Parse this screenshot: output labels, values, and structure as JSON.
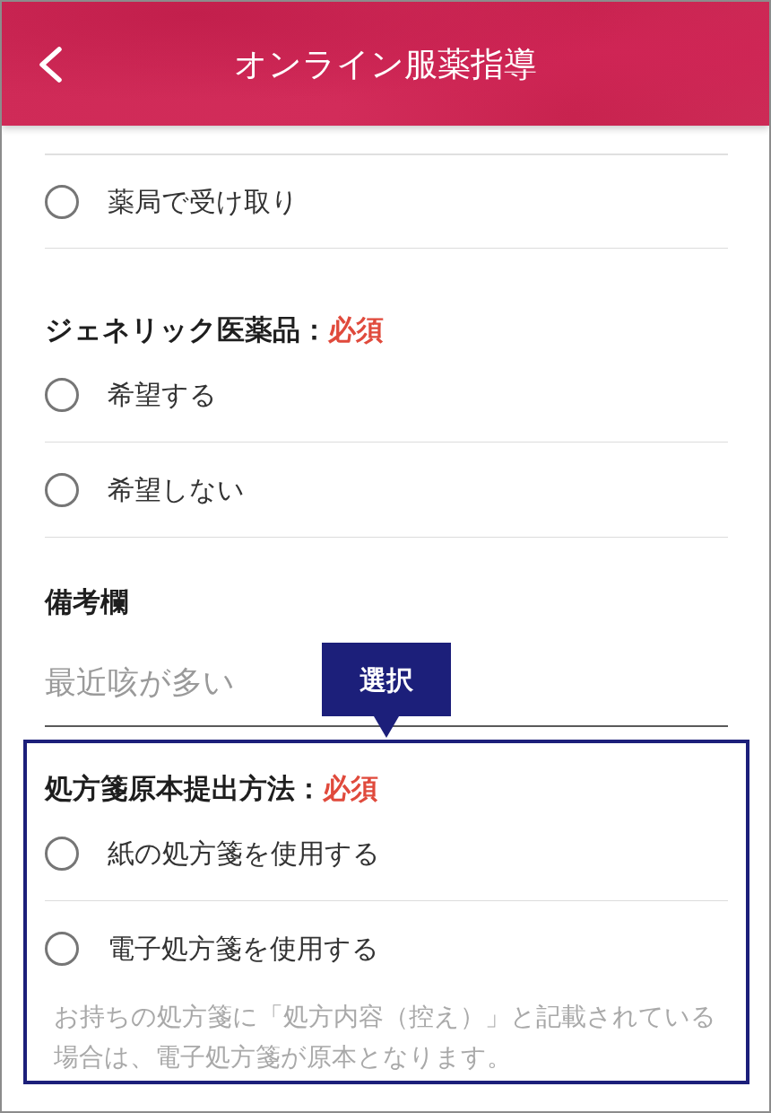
{
  "header": {
    "title": "オンライン服薬指導"
  },
  "sections": [
    {
      "kind": "radio-group",
      "options": [
        {
          "label": "薬局で受け取り",
          "selected": false
        }
      ]
    },
    {
      "kind": "radio-group",
      "label": "ジェネリック医薬品：",
      "required": "必須",
      "options": [
        {
          "label": "希望する",
          "selected": false
        },
        {
          "label": "希望しない",
          "selected": false
        }
      ]
    },
    {
      "kind": "text-field",
      "label": "備考欄",
      "value": "最近咳が多い"
    },
    {
      "kind": "radio-group",
      "label": "処方箋原本提出方法：",
      "required": "必須",
      "highlighted": true,
      "callout": "選択",
      "options": [
        {
          "label": "紙の処方箋を使用する",
          "selected": false
        },
        {
          "label": "電子処方箋を使用する",
          "selected": false
        }
      ],
      "note": "お持ちの処方箋に「処方内容（控え）」と記載されている場合は、電子処方箋が原本となります。"
    }
  ]
}
